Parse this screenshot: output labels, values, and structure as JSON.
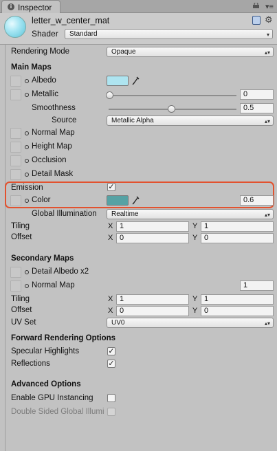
{
  "tab": {
    "title": "Inspector",
    "icon": "info-icon"
  },
  "header": {
    "material_name": "letter_w_center_mat",
    "shader_label": "Shader",
    "shader_value": "Standard"
  },
  "rendering_mode": {
    "label": "Rendering Mode",
    "value": "Opaque"
  },
  "main_maps": {
    "heading": "Main Maps",
    "albedo_label": "Albedo",
    "albedo_color": "#aee4f0",
    "metallic_label": "Metallic",
    "metallic_value": "0",
    "smoothness_label": "Smoothness",
    "smoothness_value": "0.5",
    "source_label": "Source",
    "source_value": "Metallic Alpha",
    "normal_map_label": "Normal Map",
    "height_map_label": "Height Map",
    "occlusion_label": "Occlusion",
    "detail_mask_label": "Detail Mask",
    "emission_label": "Emission",
    "emission_checked": true,
    "color_label": "Color",
    "emission_color": "#56a2a4",
    "emission_intensity": "0.6",
    "gi_label": "Global Illumination",
    "gi_value": "Realtime",
    "tiling_label": "Tiling",
    "tiling_x": "1",
    "tiling_y": "1",
    "offset_label": "Offset",
    "offset_x": "0",
    "offset_y": "0"
  },
  "secondary_maps": {
    "heading": "Secondary Maps",
    "detail_albedo_label": "Detail Albedo x2",
    "normal_map_label": "Normal Map",
    "normal_map_value": "1",
    "tiling_label": "Tiling",
    "tiling_x": "1",
    "tiling_y": "1",
    "offset_label": "Offset",
    "offset_x": "0",
    "offset_y": "0",
    "uvset_label": "UV Set",
    "uvset_value": "UV0"
  },
  "forward": {
    "heading": "Forward Rendering Options",
    "specular_label": "Specular Highlights",
    "specular_checked": true,
    "reflections_label": "Reflections",
    "reflections_checked": true
  },
  "advanced": {
    "heading": "Advanced Options",
    "gpu_label": "Enable GPU Instancing",
    "gpu_checked": false,
    "double_sided_label": "Double Sided Global Illumi",
    "double_sided_checked": false
  },
  "axis": {
    "x": "X",
    "y": "Y"
  },
  "glyphs": {
    "check": "✓",
    "dropdown_arrows": "▴▾",
    "gear": "⚙",
    "menu": "▾≡"
  }
}
